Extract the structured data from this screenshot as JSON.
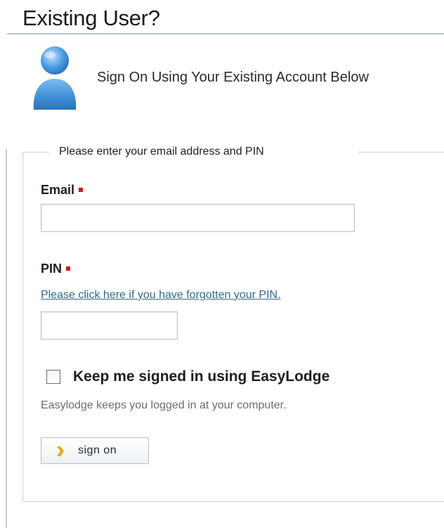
{
  "header": {
    "title": "Existing User?"
  },
  "intro": {
    "icon": "user-icon",
    "text": "Sign On Using Your Existing Account Below"
  },
  "form": {
    "legend": "Please enter your email address and PIN",
    "email": {
      "label": "Email",
      "value": "",
      "required": true
    },
    "pin": {
      "label": "PIN",
      "value": "",
      "required": true,
      "forgot_link": "Please click here if you have forgotten your PIN."
    },
    "keep_signed_in": {
      "label": "Keep me signed in using EasyLodge",
      "checked": false,
      "help": "Easylodge keeps you logged in at your computer."
    },
    "submit": {
      "label": "sign on",
      "icon": "arrow-icon"
    }
  },
  "colors": {
    "accent_link": "#2f6b8c",
    "required_marker": "#d8101c",
    "avatar_blue": "#3d8fd6",
    "button_arrow": "#f0a800"
  }
}
